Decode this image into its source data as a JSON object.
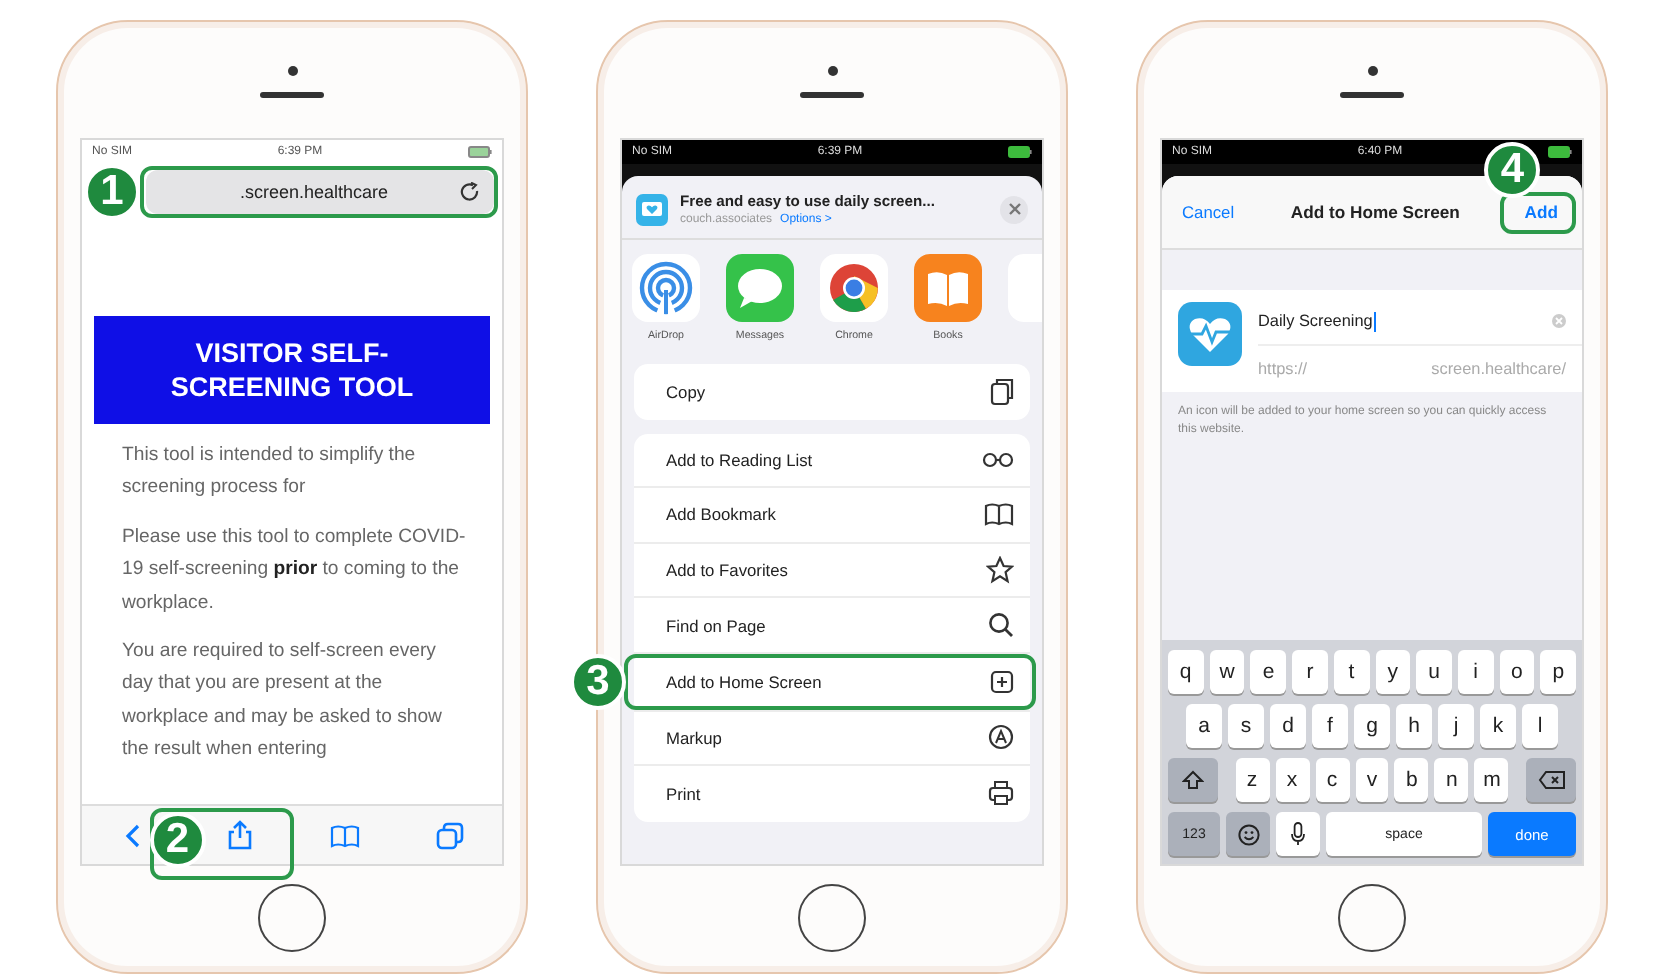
{
  "phones": [
    {
      "kind": "browser",
      "status_bar": {
        "carrier": "No SIM",
        "time": "6:39 PM"
      },
      "url_bar": {
        "text": ".screen.healthcare",
        "callout": "1"
      },
      "banner": "VISITOR SELF-SCREENING TOOL",
      "paragraphs": [
        "This tool is intended to simplify the screening process for",
        "Please use this tool to complete COVID-19 self-screening **prior** to coming to the workplace.",
        "You are required to self-screen every day that you are present at the workplace and may be asked to show the result when entering"
      ],
      "toolbar": [
        {
          "kind": "back"
        },
        {
          "kind": "share",
          "callout": "2"
        },
        {
          "kind": "book"
        },
        {
          "kind": "tabs"
        }
      ]
    },
    {
      "kind": "share_sheet",
      "status_bar": {
        "carrier": "No SIM",
        "time": "6:39 PM"
      },
      "header": {
        "title": "Free and easy to use daily screen...",
        "subtitle": "couch.associates",
        "options": "Options >"
      },
      "apps": [
        {
          "kind": "airdrop",
          "label": "AirDrop"
        },
        {
          "kind": "messages",
          "label": "Messages"
        },
        {
          "kind": "chrome",
          "label": "Chrome"
        },
        {
          "kind": "books",
          "label": "Books"
        },
        {
          "kind": "more"
        }
      ],
      "action_groups": [
        [
          {
            "label": "Copy",
            "kind": "copy"
          }
        ],
        [
          {
            "label": "Add to Reading List",
            "kind": "glasses"
          },
          {
            "label": "Add Bookmark",
            "kind": "book"
          },
          {
            "label": "Add to Favorites",
            "kind": "star"
          },
          {
            "label": "Find on Page",
            "kind": "search"
          },
          {
            "label": "Add to Home Screen",
            "kind": "plus-square",
            "callout": "3"
          },
          {
            "label": "Markup",
            "kind": "markup"
          },
          {
            "label": "Print",
            "kind": "print"
          }
        ]
      ]
    },
    {
      "kind": "add_home",
      "status_bar": {
        "carrier": "No SIM",
        "time": "6:40 PM"
      },
      "nav": {
        "cancel": "Cancel",
        "title": "Add to Home Screen",
        "confirm": {
          "label": "Add",
          "callout": "4"
        }
      },
      "name_field": {
        "value": "Daily Screening"
      },
      "url": {
        "scheme": "https://",
        "host": "screen.healthcare/"
      },
      "note": "An icon will be added to your home screen so you can quickly access this website.",
      "keyboard": [
        [
          {
            "kind": "letter",
            "label": "q"
          },
          {
            "kind": "letter",
            "label": "w"
          },
          {
            "kind": "letter",
            "label": "e"
          },
          {
            "kind": "letter",
            "label": "r"
          },
          {
            "kind": "letter",
            "label": "t"
          },
          {
            "kind": "letter",
            "label": "y"
          },
          {
            "kind": "letter",
            "label": "u"
          },
          {
            "kind": "letter",
            "label": "i"
          },
          {
            "kind": "letter",
            "label": "o"
          },
          {
            "kind": "letter",
            "label": "p"
          }
        ],
        [
          {
            "kind": "letter",
            "label": "a"
          },
          {
            "kind": "letter",
            "label": "s"
          },
          {
            "kind": "letter",
            "label": "d"
          },
          {
            "kind": "letter",
            "label": "f"
          },
          {
            "kind": "letter",
            "label": "g"
          },
          {
            "kind": "letter",
            "label": "h"
          },
          {
            "kind": "letter",
            "label": "j"
          },
          {
            "kind": "letter",
            "label": "k"
          },
          {
            "kind": "letter",
            "label": "l"
          }
        ],
        [
          {
            "kind": "shift"
          },
          {
            "kind": "letter",
            "label": "z"
          },
          {
            "kind": "letter",
            "label": "x"
          },
          {
            "kind": "letter",
            "label": "c"
          },
          {
            "kind": "letter",
            "label": "v"
          },
          {
            "kind": "letter",
            "label": "b"
          },
          {
            "kind": "letter",
            "label": "n"
          },
          {
            "kind": "letter",
            "label": "m"
          },
          {
            "kind": "backspace"
          }
        ],
        [
          {
            "kind": "numbers",
            "label": "123"
          },
          {
            "kind": "emoji"
          },
          {
            "kind": "mic"
          },
          {
            "kind": "space",
            "label": "space"
          },
          {
            "kind": "done",
            "label": "done"
          }
        ]
      ]
    }
  ]
}
